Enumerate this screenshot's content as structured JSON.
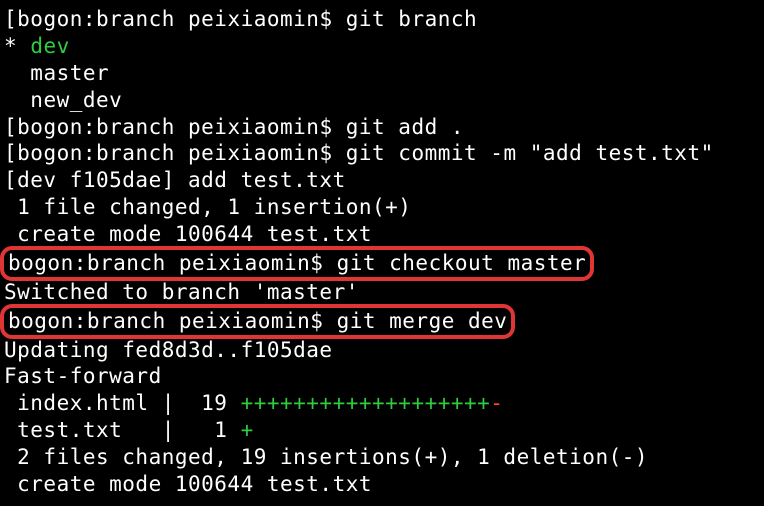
{
  "prompt": {
    "host": "bogon",
    "dir": "branch",
    "user": "peixiaomin",
    "dollar": "$"
  },
  "commands": {
    "git_branch": "git branch",
    "git_add": "git add .",
    "git_commit": "git commit -m \"add test.txt\"",
    "git_checkout": "git checkout master",
    "git_merge": "git merge dev"
  },
  "output": {
    "branch_current_marker": "*",
    "branch_current": "dev",
    "branch_master": "master",
    "branch_new_dev": "new_dev",
    "commit_hash_line": "[dev f105dae] add test.txt",
    "commit_changed": " 1 file changed, 1 insertion(+)",
    "commit_create_mode": " create mode 100644 test.txt",
    "switched": "Switched to branch 'master'",
    "updating": "Updating fed8d3d..f105dae",
    "fast_forward": "Fast-forward",
    "diff_index_prefix": " index.html |  19 ",
    "diff_index_plus": "+++++++++++++++++++",
    "diff_index_minus": "-",
    "diff_test_prefix": " test.txt   |   1 ",
    "diff_test_plus": "+",
    "summary": " 2 files changed, 19 insertions(+), 1 deletion(-)",
    "create_mode2": " create mode 100644 test.txt"
  },
  "prompts_full": {
    "p1": "[bogon:branch peixiaomin$ ",
    "p2": "bogon:branch peixiaomin$ "
  }
}
